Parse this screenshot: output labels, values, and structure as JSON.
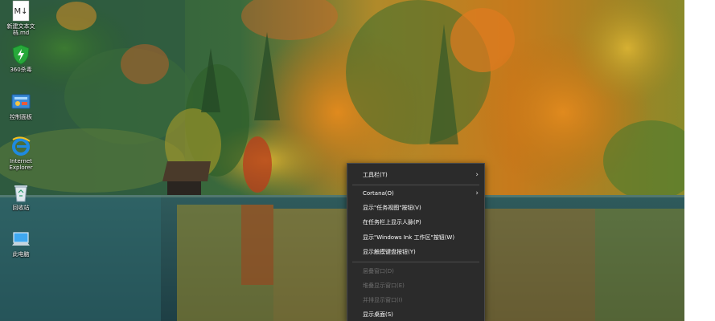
{
  "desktop_icons": [
    {
      "id": "new-text-file",
      "label": "新建文本文\n档.md",
      "icon": "markdown-file-icon"
    },
    {
      "id": "security-360",
      "label": "360杀毒",
      "icon": "shield-360-icon"
    },
    {
      "id": "control-panel",
      "label": "控制面板",
      "icon": "control-panel-icon"
    },
    {
      "id": "internet-explorer",
      "label": "Internet\nExplorer",
      "icon": "ie-icon"
    },
    {
      "id": "recycle-bin",
      "label": "回收站",
      "icon": "recycle-bin-icon"
    },
    {
      "id": "this-pc",
      "label": "此电脑",
      "icon": "computer-icon"
    }
  ],
  "md_icon_text": "M↓",
  "context_menu": {
    "items": [
      {
        "label": "工具栏(T)",
        "enabled": true,
        "submenu": true
      },
      {
        "label": "Cortana(O)",
        "enabled": true,
        "submenu": true
      },
      {
        "label": "显示\"任务视图\"按钮(V)",
        "enabled": true,
        "submenu": false
      },
      {
        "label": "在任务栏上显示人脉(P)",
        "enabled": true,
        "submenu": false
      },
      {
        "label": "显示\"Windows Ink 工作区\"按钮(W)",
        "enabled": true,
        "submenu": false
      },
      {
        "label": "显示触摸键盘按钮(Y)",
        "enabled": true,
        "submenu": false
      },
      {
        "label": "层叠窗口(D)",
        "enabled": false,
        "submenu": false
      },
      {
        "label": "堆叠显示窗口(E)",
        "enabled": false,
        "submenu": false
      },
      {
        "label": "并排显示窗口(I)",
        "enabled": false,
        "submenu": false
      },
      {
        "label": "显示桌面(S)",
        "enabled": true,
        "submenu": false
      }
    ],
    "submenu_arrow": "›"
  },
  "colors": {
    "menu_bg": "#2b2b2b",
    "menu_text": "#ffffff",
    "menu_disabled": "#6d6d6d"
  }
}
